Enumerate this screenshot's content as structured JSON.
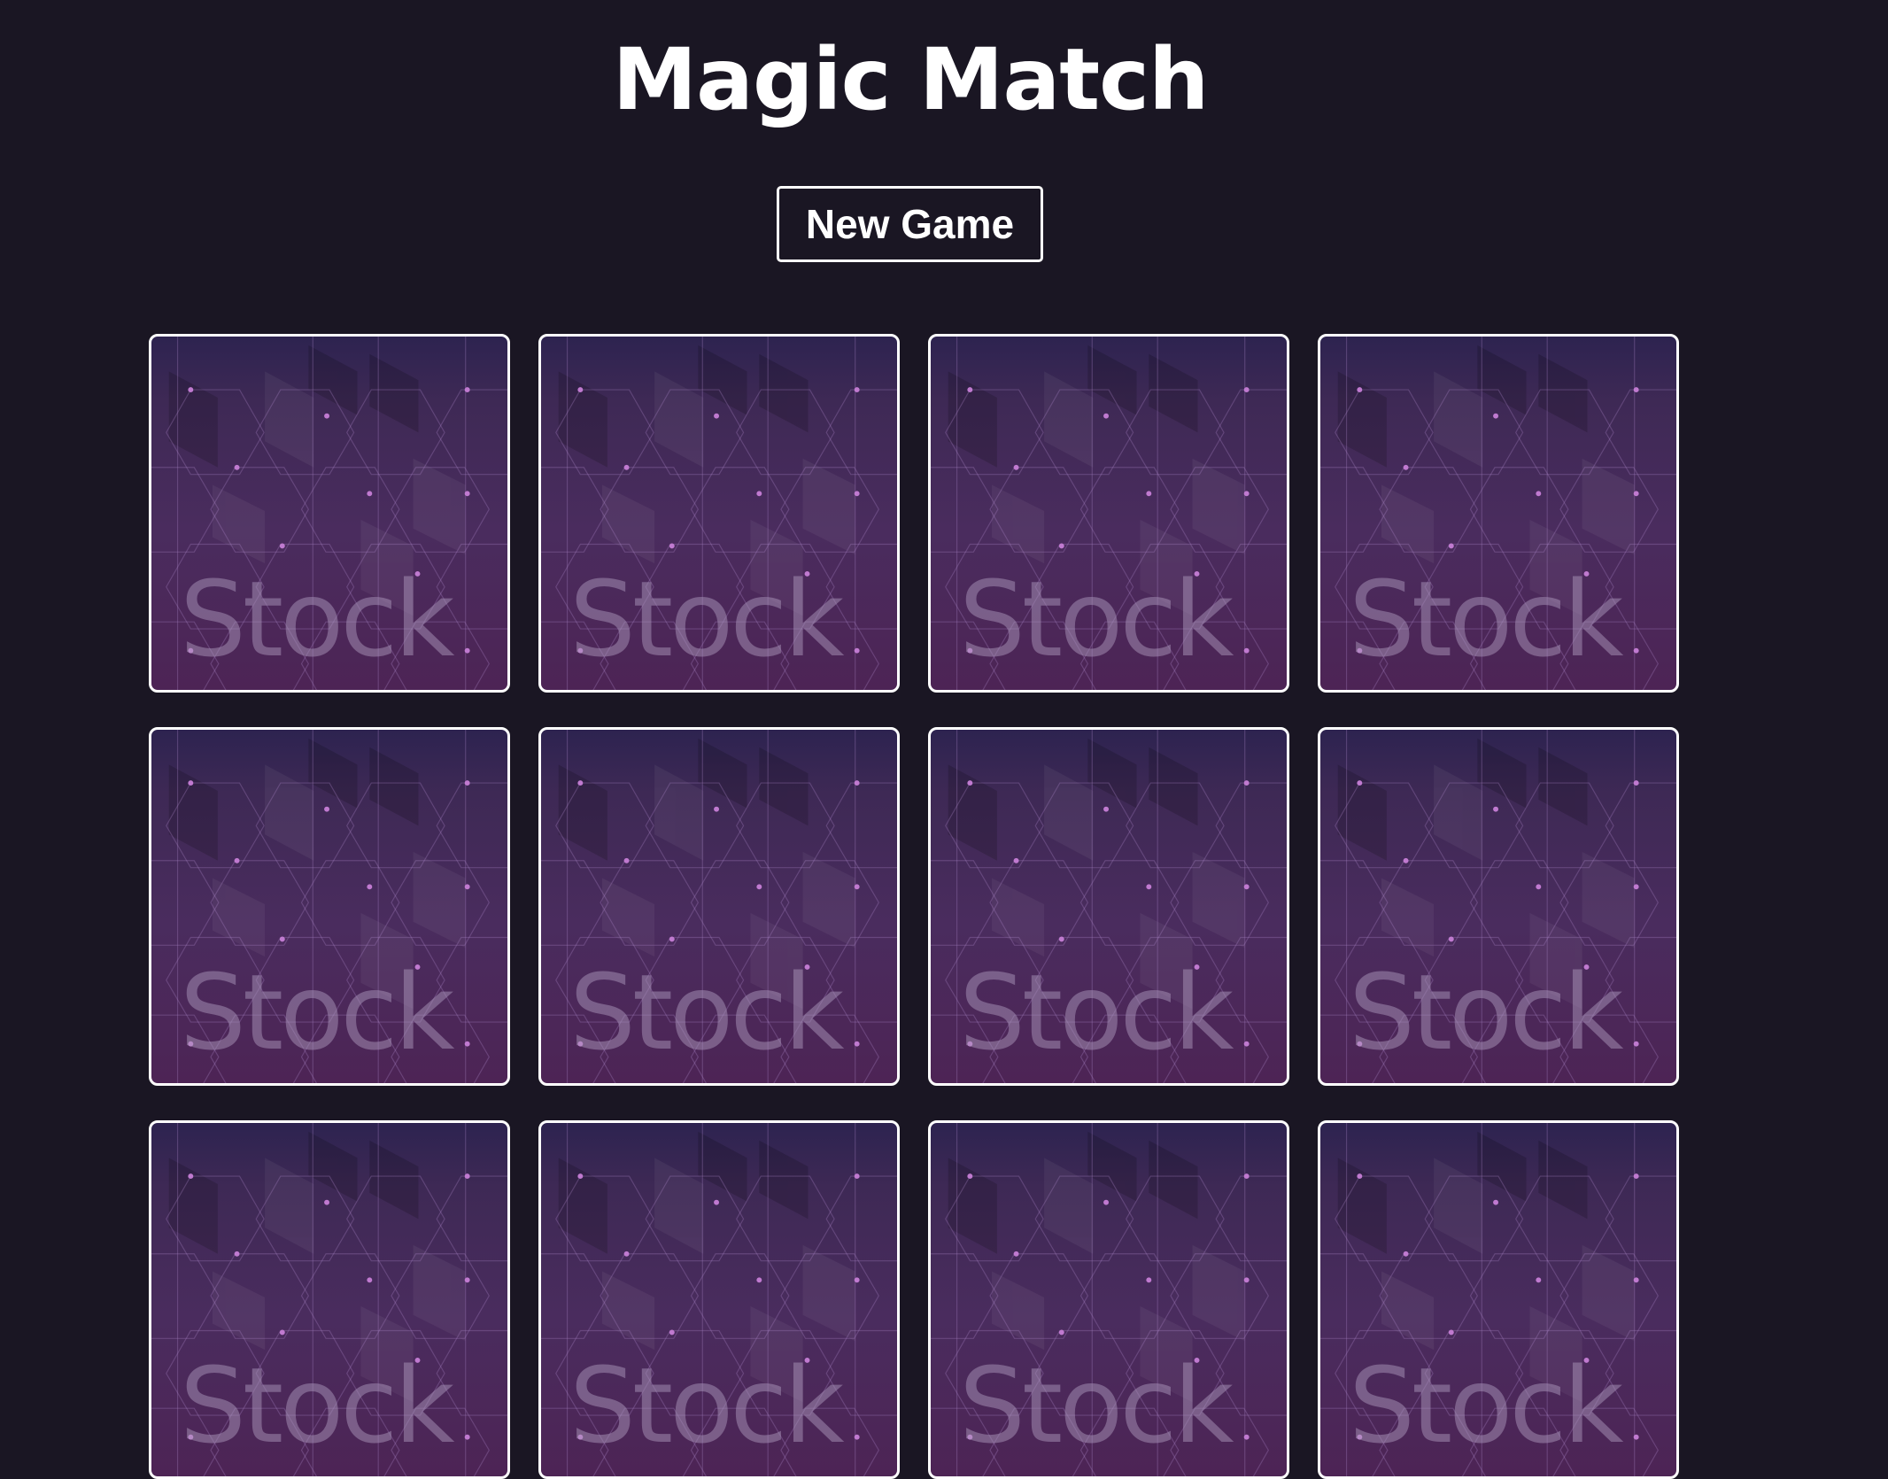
{
  "app": {
    "title": "Magic Match"
  },
  "controls": {
    "new_game_label": "New Game"
  },
  "board": {
    "card_back_text": "Stock",
    "cards": [
      {
        "state": "face-down"
      },
      {
        "state": "face-down"
      },
      {
        "state": "face-down"
      },
      {
        "state": "face-down"
      },
      {
        "state": "face-down"
      },
      {
        "state": "face-down"
      },
      {
        "state": "face-down"
      },
      {
        "state": "face-down"
      },
      {
        "state": "face-down"
      },
      {
        "state": "face-down"
      },
      {
        "state": "face-down"
      },
      {
        "state": "face-down"
      }
    ]
  },
  "colors": {
    "background": "#1a1623",
    "card_border": "#ffffff",
    "card_back_top": "#2d2350",
    "card_back_bottom": "#4d2455",
    "accent_dot": "#c07ad0"
  }
}
